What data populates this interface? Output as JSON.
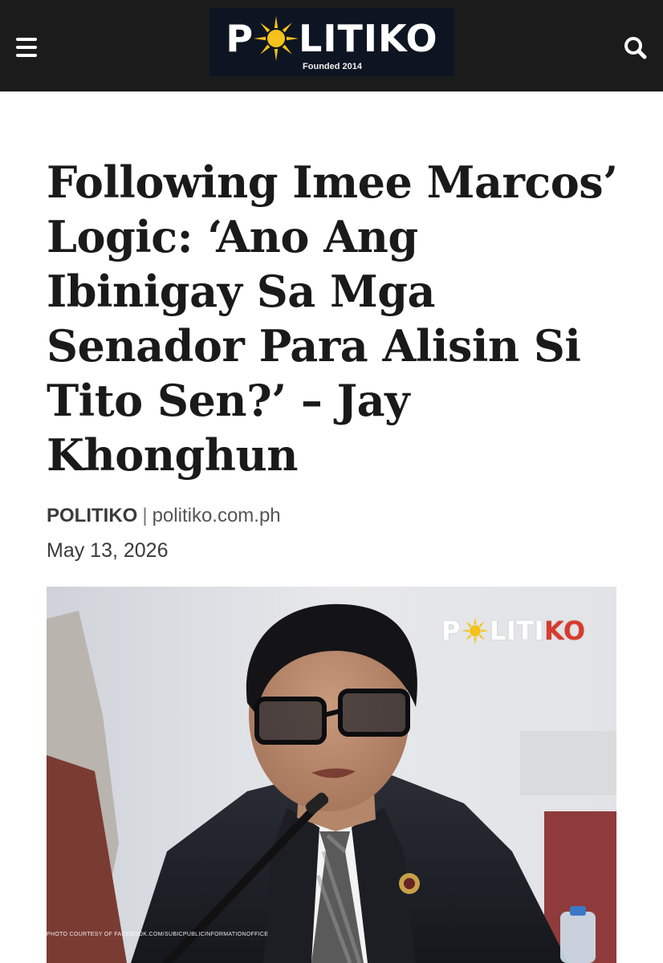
{
  "header": {
    "logo_text_left": "P",
    "logo_text_right": "LITIKO",
    "logo_tagline": "Founded 2014",
    "menu_icon": "hamburger-menu-icon",
    "search_icon": "search-icon"
  },
  "article": {
    "headline": "Following Imee Marcos’ Logic: ‘Ano Ang Ibinigay Sa Mga Senador Para Alisin Si Tito Sen?’ – Jay Khonghun",
    "author": "POLITIKO",
    "source": "politiko.com.ph",
    "date": "May 13, 2026"
  },
  "featured_image": {
    "watermark_left": "P",
    "watermark_mid": "LITI",
    "watermark_right": "KO",
    "credit": "PHOTO COURTESY OF FACEBOOK.COM/SUBICPUBLICINFORMATIONOFFICE"
  },
  "colors": {
    "header_bg": "#1b1b1b",
    "logo_bg": "#0e1522",
    "sun_yellow": "#f4c21a",
    "brand_red": "#d83a2e",
    "headline": "#1a1a1a"
  }
}
